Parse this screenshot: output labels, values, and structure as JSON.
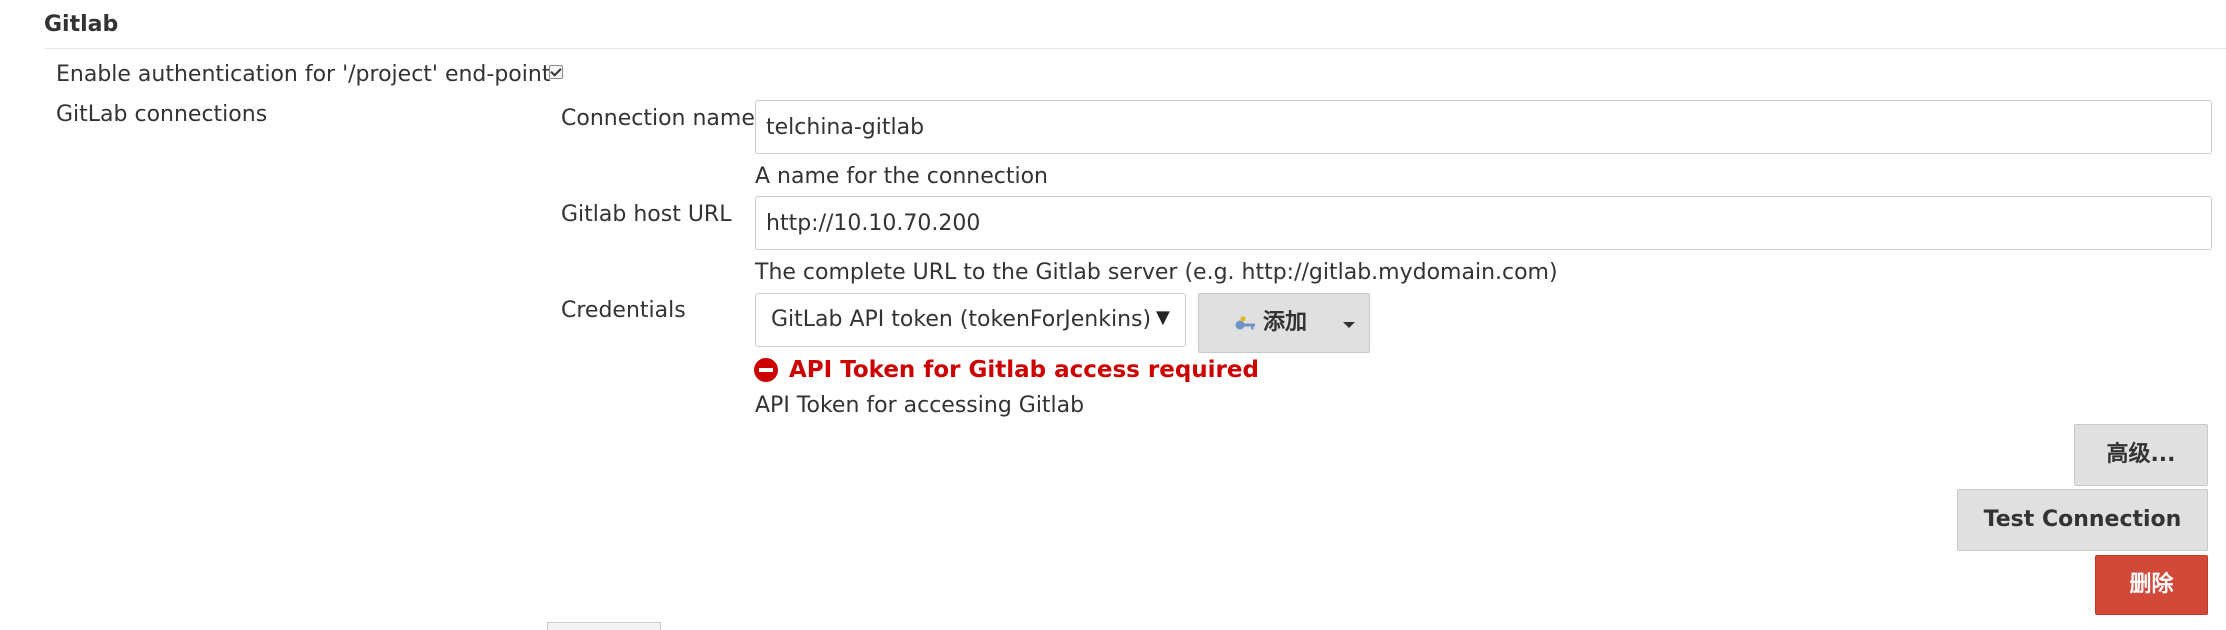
{
  "section": {
    "title": "Gitlab"
  },
  "auth": {
    "label": "Enable authentication for '/project' end-point",
    "checked": true
  },
  "connections": {
    "label": "GitLab connections",
    "connection_name": {
      "label": "Connection name",
      "value": "telchina-gitlab",
      "help": "A name for the connection"
    },
    "host_url": {
      "label": "Gitlab host URL",
      "value": "http://10.10.70.200",
      "help": "The complete URL to the Gitlab server (e.g. http://gitlab.mydomain.com)"
    },
    "credentials": {
      "label": "Credentials",
      "selected": "GitLab API token (tokenForJenkins)",
      "add_label": "添加",
      "error": "API Token for Gitlab access required",
      "help": "API Token for accessing Gitlab"
    },
    "buttons": {
      "advanced": "高级...",
      "test": "Test Connection",
      "delete": "删除"
    }
  },
  "colors": {
    "error": "#cc0000",
    "delete_button": "#d24939",
    "button_bg": "#e0e0e0"
  },
  "icons": {
    "checkbox": "checkmark",
    "error": "error-circle-icon",
    "key": "key-icon",
    "dropdown": "caret-down-icon"
  }
}
